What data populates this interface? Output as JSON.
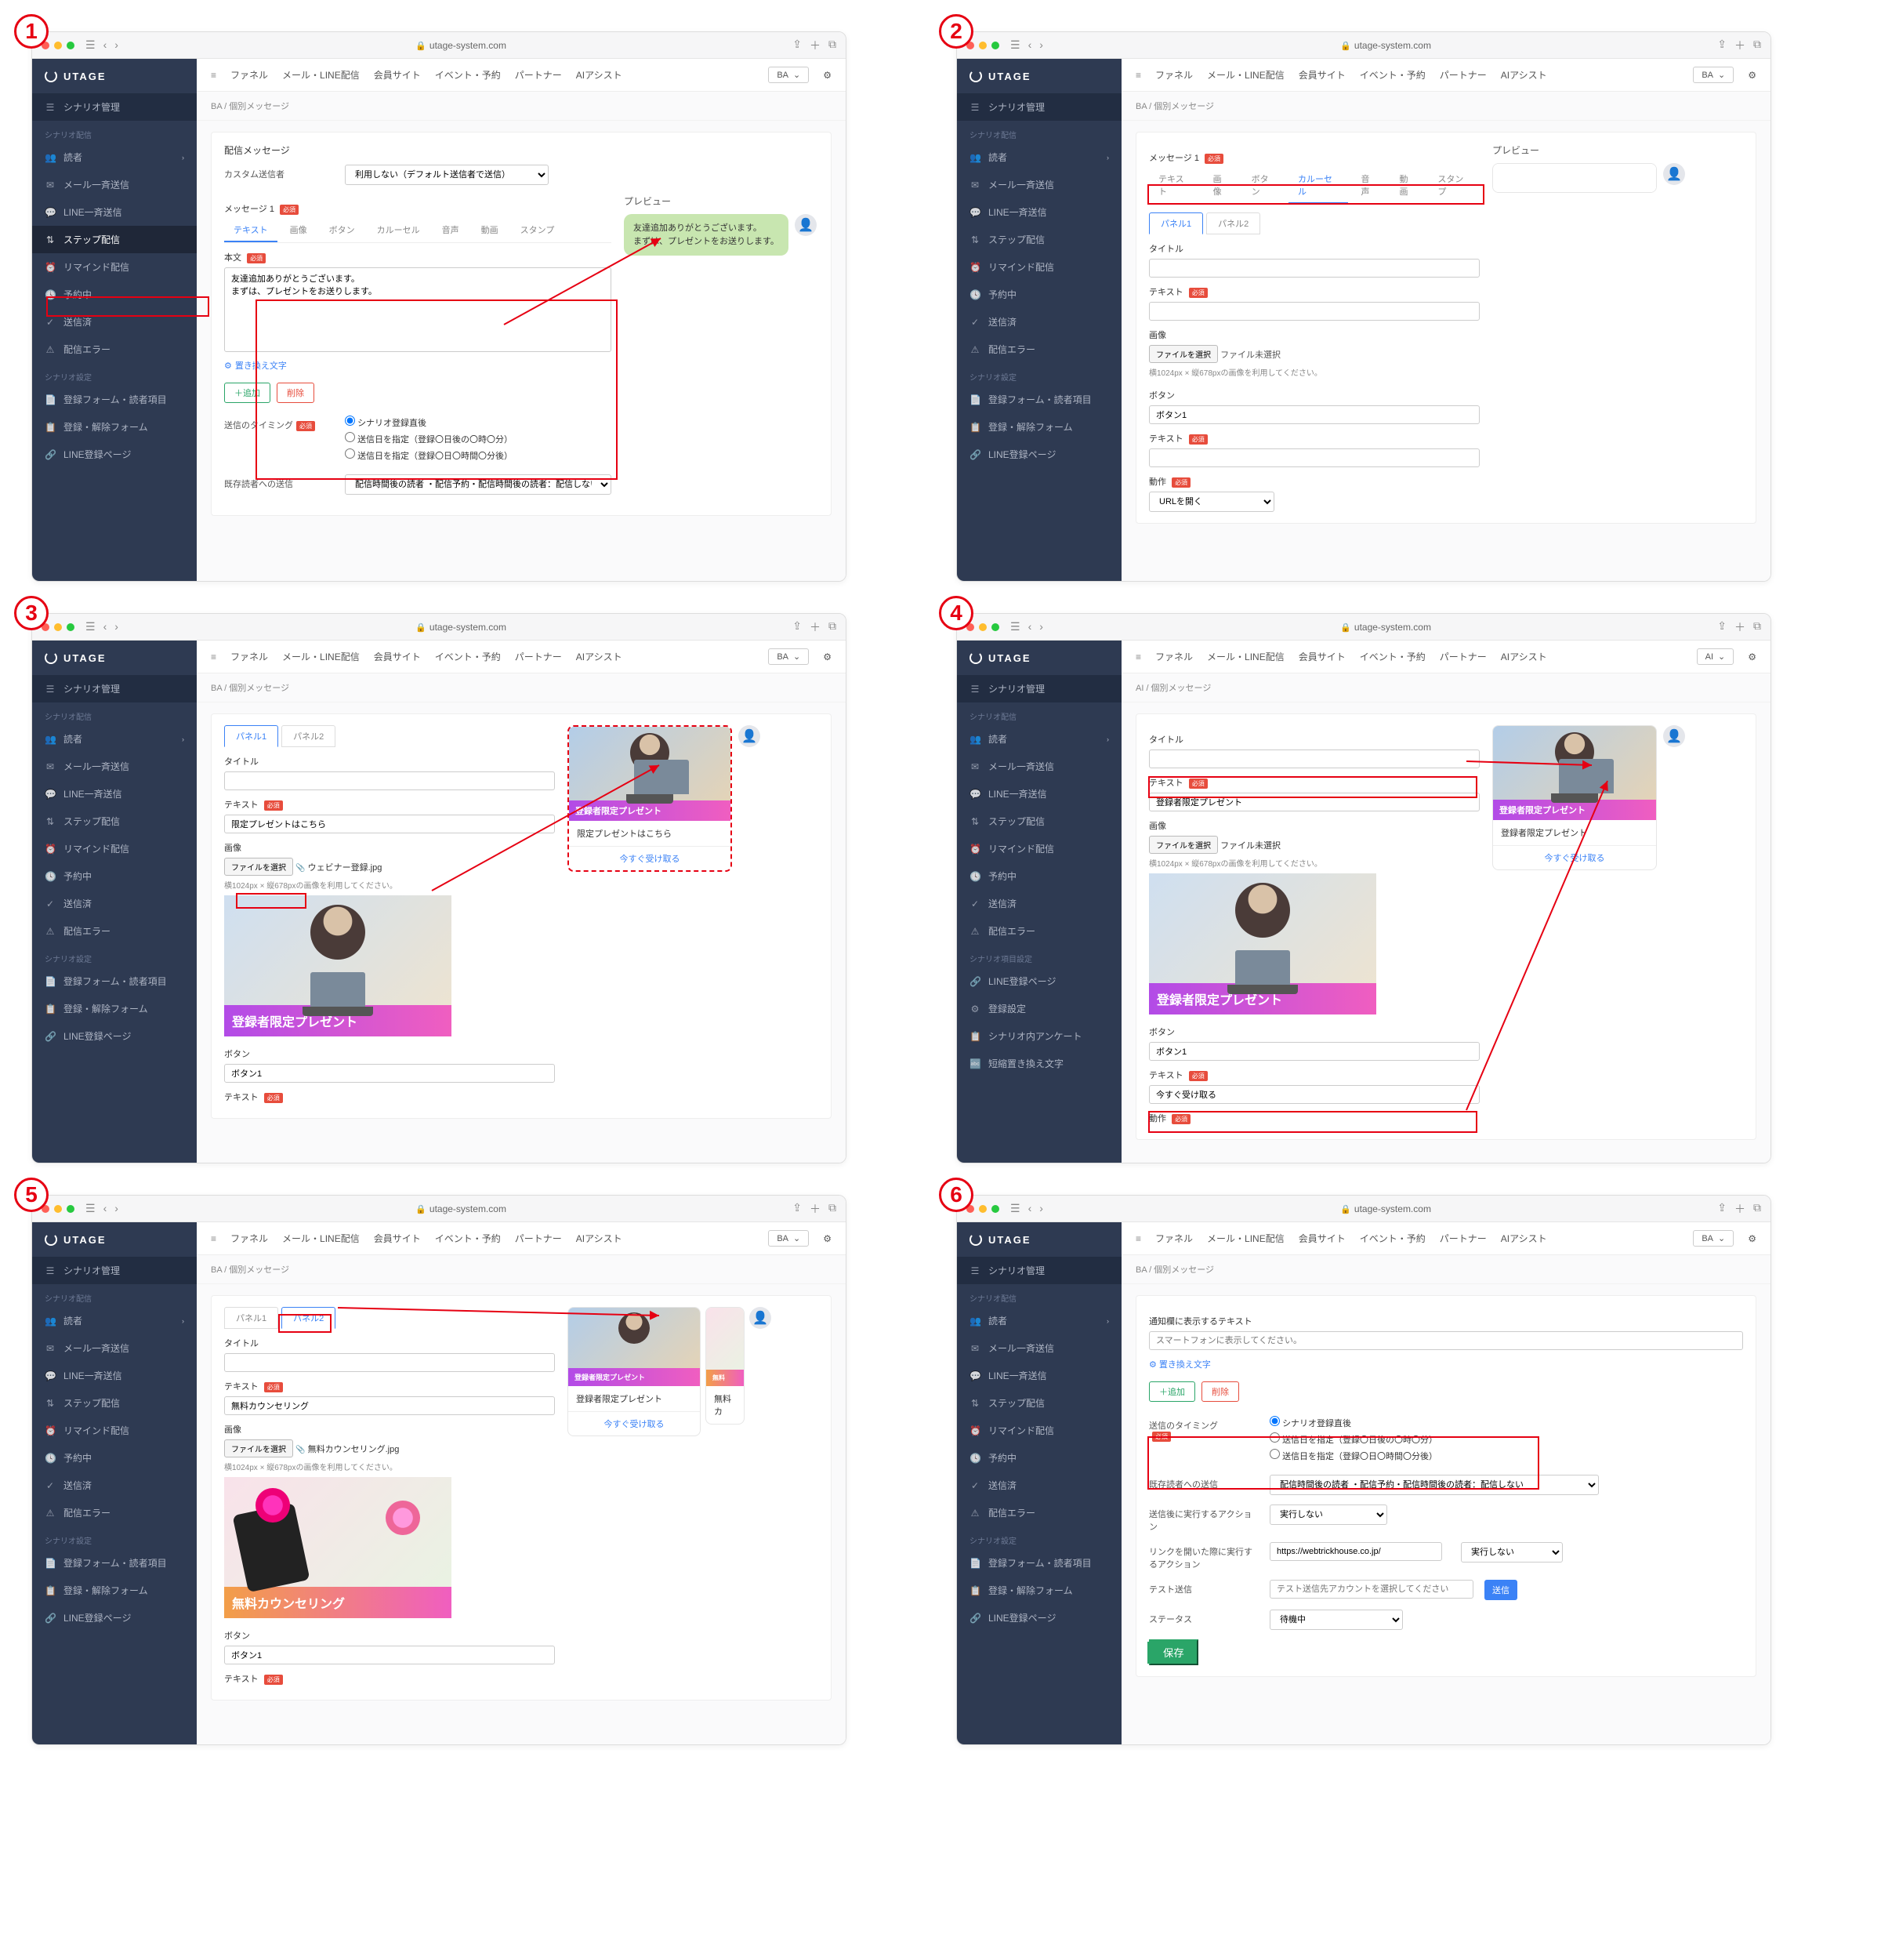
{
  "brand": "UTAGE",
  "url_host": "utage-system.com",
  "topnav": [
    "ファネル",
    "メール・LINE配信",
    "会員サイト",
    "イベント・予約",
    "パートナー",
    "AIアシスト"
  ],
  "account": "BA",
  "account_alt": "AI",
  "sidebar": {
    "head": "シナリオ管理",
    "sec1": "シナリオ配信",
    "items1": [
      "読者",
      "メール一斉送信",
      "LINE一斉送信",
      "ステップ配信",
      "リマインド配信",
      "予約中",
      "送信済",
      "配信エラー"
    ],
    "sec2": "シナリオ設定",
    "items2": [
      "登録フォーム・読者項目",
      "登録・解除フォーム",
      "LINE登録ページ"
    ],
    "sec2b": "シナリオ項目設定",
    "items2b": [
      "LINE登録ページ",
      "登録設定",
      "シナリオ内アンケート",
      "短縮置き換え文字"
    ]
  },
  "crumb": "BA / 個別メッセージ",
  "crumb_ai": "AI / 個別メッセージ",
  "labels": {
    "deliver_msg": "配信メッセージ",
    "custom_sender": "カスタム送信者",
    "sender_opt": "利用しない（デフォルト送信者で送信）",
    "message1": "メッセージ 1",
    "msg1_req": "必須",
    "body": "本文",
    "preview": "プレビュー",
    "replace_link": "置き換え文字",
    "add": "＋追加",
    "del": "削除",
    "timing": "送信のタイミング",
    "timing_r1": "シナリオ登録直後",
    "timing_r2": "送信日を指定（登録〇日後の〇時〇分）",
    "timing_r3": "送信日を指定（登録〇日〇時間〇分後）",
    "existing": "既存読者への送信",
    "existing_opt": "配信時間後の読者 ・配信予約・配信時間後の読者：配信しない",
    "title": "タイトル",
    "text": "テキスト",
    "image": "画像",
    "choose_file": "ファイルを選択",
    "no_file": "ファイル未選択",
    "img_hint": "横1024px × 縦678pxの画像を利用してください。",
    "button": "ボタン",
    "button1": "ボタン1",
    "action": "動作",
    "action_opt": "URLを開く",
    "panel1": "パネル1",
    "panel2": "パネル2",
    "notify_text": "通知欄に表示するテキスト",
    "notify_ph": "スマートフォンに表示してください。",
    "after_action": "送信後に実行するアクション",
    "link_action": "リンクを開いた際に実行するアクション",
    "none": "実行しない",
    "test_send": "テスト送信",
    "test_ph": "テスト送信先アカウントを選択してください",
    "send": "送信",
    "status": "ステータス",
    "status_v": "待機中",
    "save": "保存",
    "link_url": "https://webtrickhouse.co.jp/"
  },
  "tabs": [
    "テキスト",
    "画像",
    "ボタン",
    "カルーセル",
    "音声",
    "動画",
    "スタンプ"
  ],
  "p1": {
    "text": "友達追加ありがとうございます。\nまずは、プレゼントをお送りします。",
    "bubble": "友達追加ありがとうございます。\nまずは、プレゼントをお送りします。"
  },
  "p3": {
    "text_val": "限定プレゼントはこちら",
    "file": "ウェビナー登録.jpg",
    "ribbon": "登録者限定プレゼント",
    "pc_body": "限定プレゼントはこちら",
    "pc_btn": "今すぐ受け取る"
  },
  "p4": {
    "text_val": "登録者限定プレゼント",
    "btn_text": "今すぐ受け取る",
    "pc_body": "登録者限定プレゼント",
    "pc_btn": "今すぐ受け取る"
  },
  "p5": {
    "text_val": "無料カウンセリング",
    "file": "無料カウンセリング.jpg",
    "ribbon": "無料カウンセリング",
    "pc_body": "登録者限定プレゼント",
    "pc_btn": "今すぐ受け取る",
    "pc2": "無料カ"
  }
}
